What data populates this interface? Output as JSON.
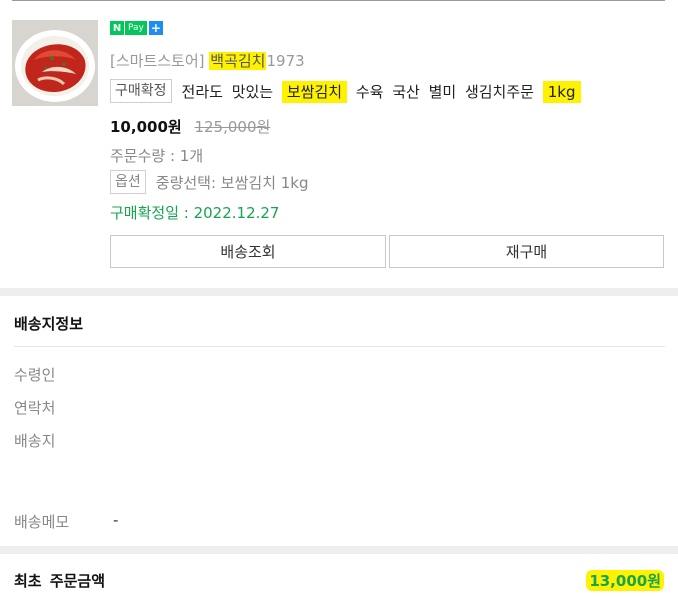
{
  "order": {
    "image_alt": "kimchi-product-image",
    "npay": {
      "n": "N",
      "pay": "Pay",
      "plus": "+"
    },
    "store": {
      "prefix": "[스마트스토어] ",
      "name": "백곡김치",
      "suffix": "1973"
    },
    "status_tag": "구매확정",
    "title": {
      "part1": "전라도 맛있는 ",
      "hl1": "보쌈김치",
      "part2": " 수육 국산 별미 생김치주문 ",
      "hl2": "1kg"
    },
    "price": {
      "current": "10,000원",
      "original": "125,000원"
    },
    "quantity": "주문수량 : 1개",
    "option_tag": "옵션",
    "option_text": "중량선택: 보쌈김치 1kg",
    "confirm_date": "구매확정일 : 2022.12.27",
    "buttons": {
      "track": "배송조회",
      "rebuy": "재구매"
    }
  },
  "delivery": {
    "title": "배송지정보",
    "fields": [
      "수령인",
      "연락처",
      "배송지"
    ],
    "memo_label": "배송메모",
    "memo_value": "-"
  },
  "total": {
    "label": "최초 주문금액",
    "value": "13,000원"
  },
  "colors": {
    "highlight": "#fff200",
    "green": "#15a550",
    "npay_green": "#03c75a",
    "npay_blue": "#1e8ef0"
  }
}
